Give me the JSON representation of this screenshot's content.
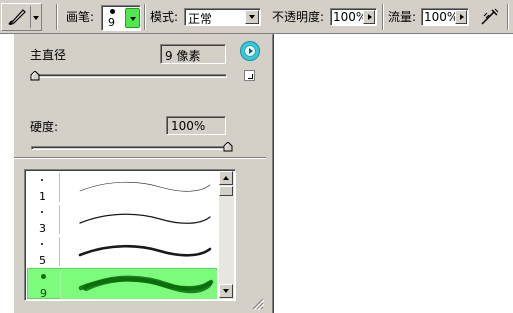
{
  "toolbar": {
    "tool_icon": "brush-tool-icon",
    "brush_label": "画笔:",
    "brush_size": "9",
    "mode_label": "模式:",
    "mode_value": "正常",
    "opacity_label": "不透明度:",
    "opacity_value": "100%",
    "flow_label": "流量:",
    "flow_value": "100%",
    "airbrush_icon": "airbrush-icon"
  },
  "panel": {
    "diameter_label": "主直径",
    "diameter_value": "9 像素",
    "diameter_level": 0.02,
    "hardness_label": "硬度:",
    "hardness_value": "100%",
    "hardness_level": 1.0,
    "menu_icon": "flyout-menu-arrow-icon",
    "brushes": [
      {
        "size": "1",
        "selected": false
      },
      {
        "size": "3",
        "selected": false
      },
      {
        "size": "5",
        "selected": false
      },
      {
        "size": "9",
        "selected": true
      }
    ]
  },
  "colors": {
    "face": "#d4d0c8",
    "selection": "#7dfb7d",
    "highlight_green": "#4fe84f",
    "menu_cyan": "#39c9d9"
  }
}
